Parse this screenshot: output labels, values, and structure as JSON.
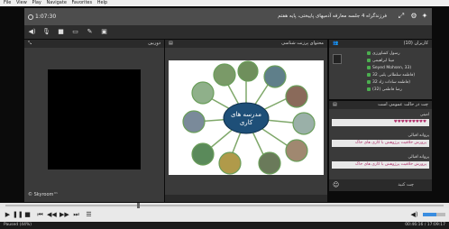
{
  "player_menu": [
    "File",
    "View",
    "Play",
    "Navigate",
    "Favorites",
    "Help"
  ],
  "meeting": {
    "timer": "1:07:30",
    "title": "فرزندگراه 4 جلسه معارفه آدمیهای پاییختی، پایه هفتم"
  },
  "video_panel": {
    "title": "دوربین",
    "logo_text": "© Skyroom™"
  },
  "presentation": {
    "title": "محتوای پرزنت شناسی"
  },
  "slide": {
    "center_text_1": "مدرسه های",
    "center_text_2": "کاری"
  },
  "users_panel": {
    "title": "کاربران (10)",
    "users": [
      "رسول کشاورزی",
      "مینا ابراهیمی",
      "Seyed Mohsen, 33)",
      "فاطمه سلطانی پلیی 32)",
      "فاطمه سادات زاد 32)",
      "رضا فاطمی (32)"
    ]
  },
  "chat_panel": {
    "title": "چت در حالت عمومی است",
    "messages": [
      {
        "sender": "امینی",
        "text": "♥♥♥♥♥♥♥♥♥"
      },
      {
        "sender": "پروانه اقبالی",
        "text": "پرورش خلاقیت پرژوهش با کاری های خاک"
      },
      {
        "sender": "پروانه اقبالی",
        "text": "پرورش خلاقیت پرژوهش با کاری های خاک"
      }
    ],
    "input_placeholder": "چت کنید"
  },
  "player": {
    "status_left": "Paused (44%)",
    "status_right": "00:46:16 / 17:09:17"
  },
  "colors": {
    "presence": "#4caf50",
    "volume": "#3a8de0"
  },
  "icons": {
    "screen": "screen-icon",
    "camera": "camera-icon",
    "pen": "pen-icon"
  }
}
